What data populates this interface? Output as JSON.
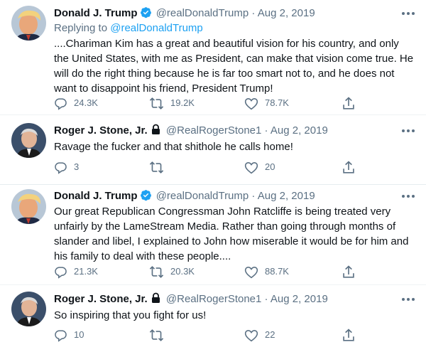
{
  "colors": {
    "accent": "#1da1f2",
    "muted": "#5b7083",
    "text": "#0f1419"
  },
  "tweets": [
    {
      "name": "Donald J. Trump",
      "handle": "@realDonaldTrump",
      "dot": "·",
      "date": "Aug 2, 2019",
      "verified": true,
      "replying_prefix": "Replying to ",
      "replying_to": "@realDonaldTrump",
      "text": "....Chariman Kim has a great and beautiful vision for his country, and only the United States, with me as President, can make that vision come true. He will do the right thing because he is far too smart not to, and he does not want to disappoint his friend, President Trump!",
      "replies": "24.3K",
      "retweets": "19.2K",
      "likes": "78.7K"
    },
    {
      "name": "Roger J. Stone, Jr.",
      "handle": "@RealRogerStone1",
      "dot": "·",
      "date": "Aug 2, 2019",
      "protected": true,
      "text": "Ravage the fucker and that shithole he calls home!",
      "replies": "3",
      "retweets": "",
      "likes": "20"
    },
    {
      "name": "Donald J. Trump",
      "handle": "@realDonaldTrump",
      "dot": "·",
      "date": "Aug 2, 2019",
      "verified": true,
      "text": "Our great Republican Congressman John Ratcliffe is being treated very unfairly by the LameStream Media. Rather than going through months of slander and libel, I explained to John how miserable it would be for him and his family to deal with these people....",
      "replies": "21.3K",
      "retweets": "20.3K",
      "likes": "88.7K"
    },
    {
      "name": "Roger J. Stone, Jr.",
      "handle": "@RealRogerStone1",
      "dot": "·",
      "date": "Aug 2, 2019",
      "protected": true,
      "text": "So inspiring that you fight for us!",
      "replies": "10",
      "retweets": "",
      "likes": "22"
    }
  ]
}
